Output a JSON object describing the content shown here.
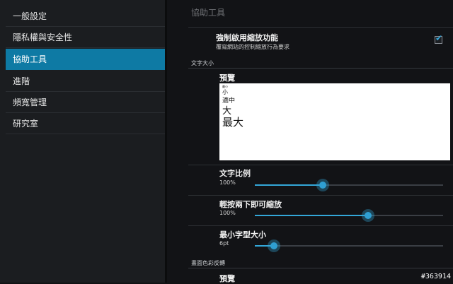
{
  "sidebar": {
    "items": [
      {
        "label": "一般設定"
      },
      {
        "label": "隱私權與安全性"
      },
      {
        "label": "協助工具"
      },
      {
        "label": "進階"
      },
      {
        "label": "頻寬管理"
      },
      {
        "label": "研究室"
      }
    ],
    "active_index": 2,
    "accent_color": "#0e7aa4"
  },
  "main": {
    "title": "協助工具",
    "force_zoom": {
      "title": "強制啟用縮放功能",
      "subtitle": "覆寫網站的控制縮放行為要求",
      "checked": true
    },
    "text_size_section": "文字大小",
    "preview": {
      "title": "預覽",
      "samples": [
        "最小",
        "小",
        "適中",
        "大",
        "最大"
      ]
    },
    "text_scale": {
      "title": "文字比例",
      "value_label": "100%",
      "fraction": 0.36
    },
    "double_tap_zoom": {
      "title": "輕按兩下即可縮放",
      "value_label": "100%",
      "fraction": 0.6
    },
    "min_font_size": {
      "title": "最小字型大小",
      "value_label": "6pt",
      "fraction": 0.1
    },
    "invert_section": "畫面色彩反轉",
    "invert_preview_title": "預覽"
  },
  "watermark": "#363914"
}
